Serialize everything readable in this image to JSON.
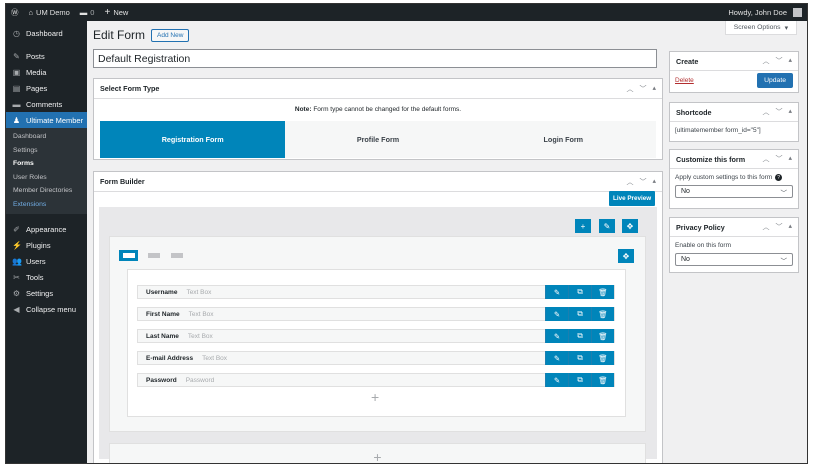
{
  "adminbar": {
    "site_name": "UM Demo",
    "comments_count": "0",
    "new_label": "New",
    "howdy": "Howdy, John Doe"
  },
  "sidebar": {
    "items_top": [
      {
        "label": "Dashboard",
        "icon": "dashboard-icon",
        "glyph": "◷"
      }
    ],
    "items_mid": [
      {
        "label": "Posts",
        "icon": "pin-icon",
        "glyph": "✎"
      },
      {
        "label": "Media",
        "icon": "media-icon",
        "glyph": "▣"
      },
      {
        "label": "Pages",
        "icon": "pages-icon",
        "glyph": "▤"
      },
      {
        "label": "Comments",
        "icon": "comments-icon",
        "glyph": "▬"
      }
    ],
    "active": {
      "label": "Ultimate Member",
      "icon": "user-icon",
      "glyph": "👤"
    },
    "submenu": [
      "Dashboard",
      "Settings",
      "Forms",
      "User Roles",
      "Member Directories",
      "Extensions"
    ],
    "items_bottom": [
      {
        "label": "Appearance",
        "icon": "brush-icon",
        "glyph": "✐"
      },
      {
        "label": "Plugins",
        "icon": "plug-icon",
        "glyph": "⚡"
      },
      {
        "label": "Users",
        "icon": "users-icon",
        "glyph": "👥"
      },
      {
        "label": "Tools",
        "icon": "wrench-icon",
        "glyph": "✂"
      },
      {
        "label": "Settings",
        "icon": "settings-icon",
        "glyph": "⚙"
      },
      {
        "label": "Collapse menu",
        "icon": "collapse-icon",
        "glyph": "◀"
      }
    ]
  },
  "header": {
    "screen_options": "Screen Options",
    "title": "Edit Form",
    "add_new": "Add New",
    "form_title": "Default Registration"
  },
  "select_type": {
    "heading": "Select Form Type",
    "note_bold": "Note:",
    "note": "Form type cannot be changed for the default forms.",
    "types": [
      "Registration Form",
      "Profile Form",
      "Login Form"
    ],
    "selected": "Registration Form"
  },
  "builder": {
    "heading": "Form Builder",
    "live_preview": "Live Preview",
    "fields": [
      {
        "label": "Username",
        "type": "Text Box"
      },
      {
        "label": "First Name",
        "type": "Text Box"
      },
      {
        "label": "Last Name",
        "type": "Text Box"
      },
      {
        "label": "E-mail Address",
        "type": "Text Box"
      },
      {
        "label": "Password",
        "type": "Password"
      }
    ]
  },
  "publish": {
    "heading": "Create",
    "delete": "Delete",
    "update": "Update"
  },
  "shortcode": {
    "heading": "Shortcode",
    "value": "[ultimatemember form_id=\"5\"]"
  },
  "customize": {
    "heading": "Customize this form",
    "label": "Apply custom settings to this form",
    "value": "No"
  },
  "privacy": {
    "heading": "Privacy Policy",
    "label": "Enable on this form",
    "value": "No"
  },
  "colors": {
    "accent": "#0085ba",
    "wp_blue": "#2271b1",
    "admin_dark": "#1d2327"
  }
}
